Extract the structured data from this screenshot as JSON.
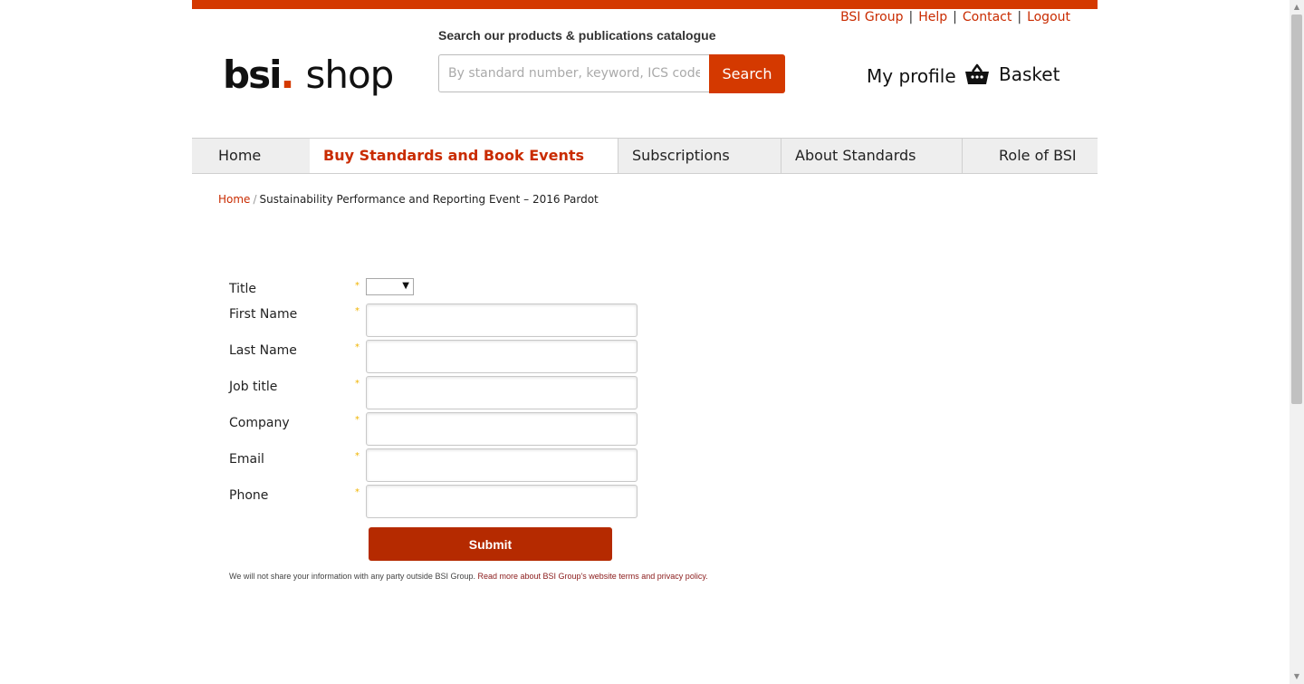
{
  "header": {
    "util_links": [
      "BSI Group",
      "Help",
      "Contact",
      "Logout"
    ],
    "logo": {
      "brand": "bsi",
      "dot": ".",
      "product": "shop"
    },
    "search": {
      "heading": "Search our products & publications catalogue",
      "placeholder": "By standard number, keyword, ICS code, ISBN",
      "button_label": "Search"
    },
    "my_profile": "My profile",
    "basket": "Basket"
  },
  "nav": {
    "items": [
      {
        "label": "Home"
      },
      {
        "label": "Buy Standards and Book Events"
      },
      {
        "label": "Subscriptions"
      },
      {
        "label": "About Standards"
      },
      {
        "label": "Role of BSI"
      }
    ]
  },
  "breadcrumb": {
    "home": "Home",
    "separator": "/",
    "current": "Sustainability Performance and Reporting Event – 2016 Pardot"
  },
  "form": {
    "required_marker": "*",
    "fields": [
      {
        "label": "Title",
        "value": ""
      },
      {
        "label": "First Name",
        "value": ""
      },
      {
        "label": "Last Name",
        "value": ""
      },
      {
        "label": "Job title",
        "value": ""
      },
      {
        "label": "Company",
        "value": ""
      },
      {
        "label": "Email",
        "value": ""
      },
      {
        "label": "Phone",
        "value": ""
      }
    ],
    "submit_label": "Submit",
    "privacy_text": "We will not share your information with any party outside BSI Group.",
    "privacy_link": "Read more about BSI Group's website terms and privacy policy."
  },
  "colors": {
    "brand_red": "#d43900",
    "submit_red": "#b52a00",
    "link_red": "#c92b00",
    "nav_bg": "#eeeeee",
    "required_star": "#f0b400"
  },
  "icons": {
    "basket": "basket-icon",
    "select_arrow": "chevron-down-icon"
  }
}
